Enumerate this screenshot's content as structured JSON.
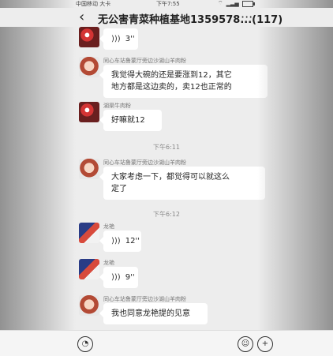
{
  "status": {
    "carrier": "中国移动 大卡",
    "time": "下午7:55",
    "icons": [
      "wifi-icon",
      "signal-icon",
      "battery-icon"
    ]
  },
  "header": {
    "back_icon": "‹",
    "title": "无公害青菜种植基地1359578...(117)",
    "more_icon": "···"
  },
  "messages": [
    {
      "type": "voice",
      "avatar": "flower",
      "sender": "",
      "duration": "3''"
    },
    {
      "type": "text",
      "avatar": "woman",
      "sender": "同心车站鲁蒙厅旁边沙湖山羊肉粉",
      "lines": [
        "我觉得大碗的还是要涨到12，其它",
        "地方都是这边卖的，卖12也正常的"
      ]
    },
    {
      "type": "text",
      "avatar": "flower",
      "sender": "湖渠牛肉粉",
      "lines": [
        "好嘛就12"
      ]
    },
    {
      "type": "time",
      "text": "下午6:11"
    },
    {
      "type": "text",
      "avatar": "woman",
      "sender": "同心车站鲁蒙厅旁边沙湖山羊肉粉",
      "lines": [
        "大家考虑一下，都觉得可以就这么",
        "定了"
      ]
    },
    {
      "type": "time",
      "text": "下午6:12"
    },
    {
      "type": "voice",
      "avatar": "book",
      "sender": "龙艳",
      "duration": "12''"
    },
    {
      "type": "voice",
      "avatar": "book",
      "sender": "龙艳",
      "duration": "9''"
    },
    {
      "type": "text",
      "avatar": "woman",
      "sender": "同心车站鲁蒙厅旁边沙湖山羊肉粉",
      "lines": [
        "我也同意龙艳提的见意"
      ]
    }
  ],
  "inputbar": {
    "voice_icon": "◔",
    "emoji_icon": "☺",
    "plus_icon": "+"
  }
}
